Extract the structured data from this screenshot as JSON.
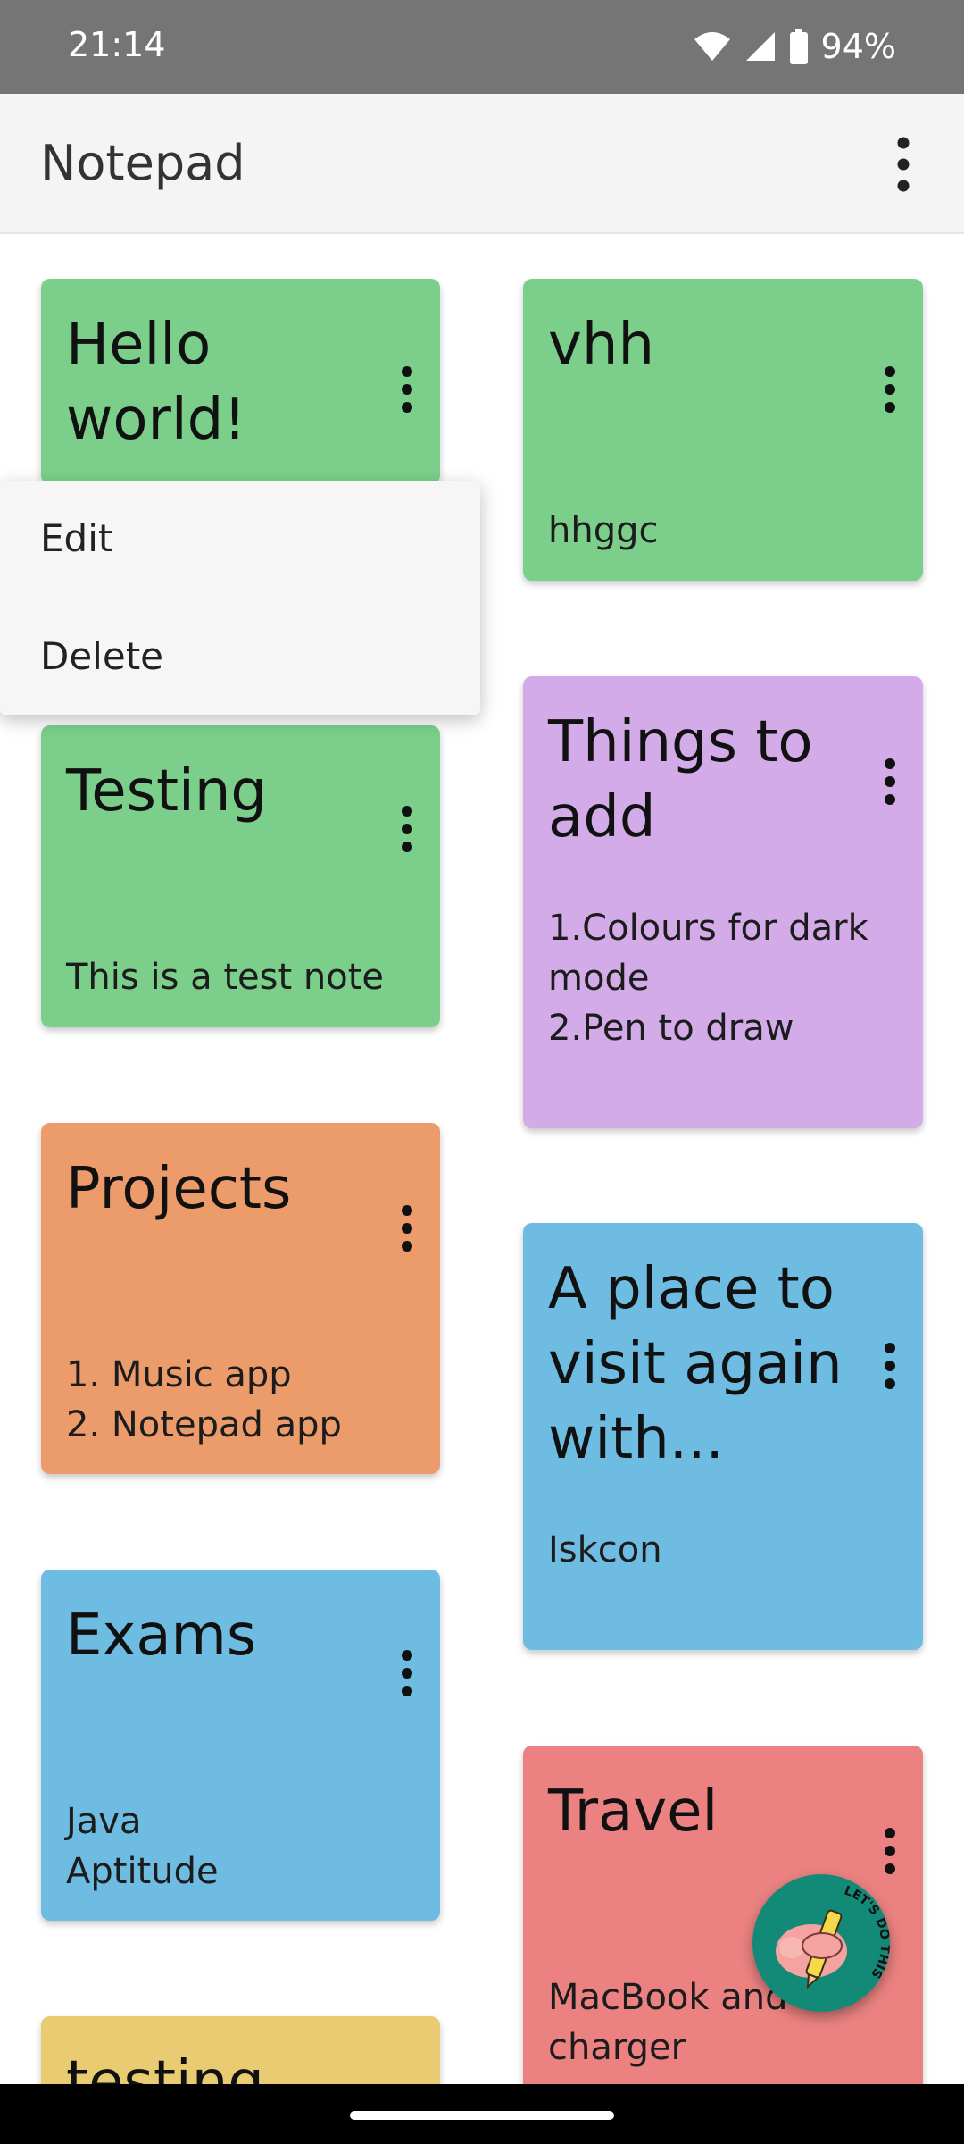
{
  "status_bar": {
    "time": "21:14",
    "battery_percent": "94%"
  },
  "app_bar": {
    "title": "Notepad"
  },
  "popup_menu": {
    "items": [
      "Edit",
      "Delete"
    ]
  },
  "notes": [
    {
      "title": "Hello world!",
      "body": "",
      "color": "#7bcf8a"
    },
    {
      "title": "vhh",
      "body": "hhggc",
      "color": "#7bcf8a"
    },
    {
      "title": "Testing",
      "body": "This is a test note",
      "color": "#7bcf8a"
    },
    {
      "title": "Things to add",
      "body": "1.Colours for dark mode\n2.Pen to draw",
      "color": "#d3abe9"
    },
    {
      "title": "Projects",
      "body": "1. Music app\n2. Notepad app",
      "color": "#ec9c6a"
    },
    {
      "title": "A place to visit again with...",
      "body": "Iskcon",
      "color": "#6ebce2"
    },
    {
      "title": "Exams",
      "body": "Java\nAptitude",
      "color": "#6ebce2"
    },
    {
      "title": "Travel",
      "body": "MacBook and\ncharger",
      "color": "#eb8281"
    },
    {
      "title": "testing",
      "body": "",
      "color": "#e9cc72"
    }
  ],
  "fab": {
    "sticker_text": "LET'S DO THIS",
    "icon": "thumbs-up-pencil-sticker",
    "color": "#138a78"
  }
}
